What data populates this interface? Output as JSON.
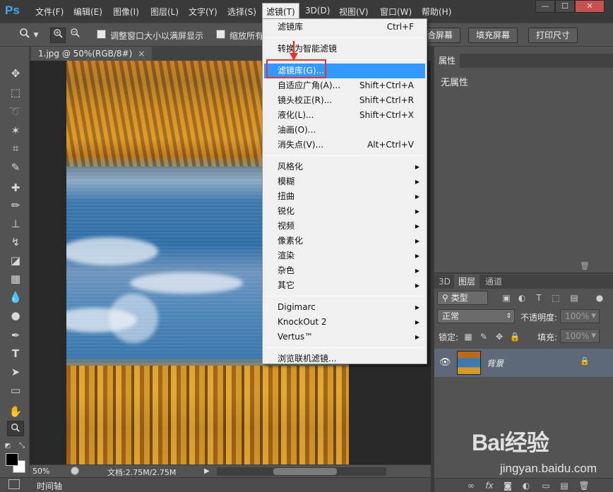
{
  "app": {
    "logo": "Ps"
  },
  "menubar": {
    "items": [
      "文件(F)",
      "编辑(E)",
      "图像(I)",
      "图层(L)",
      "文字(Y)",
      "选择(S)",
      "滤镜(T)",
      "3D(D)",
      "视图(V)",
      "窗口(W)",
      "帮助(H)"
    ],
    "active_index": 6,
    "window_buttons": [
      "—",
      "☐",
      "✕"
    ]
  },
  "options_bar": {
    "resize_windows_label": "调整窗口大小以满屏显示",
    "zoom_all_label": "缩放所有",
    "buttons": [
      "合屏幕",
      "填充屏幕",
      "打印尺寸"
    ]
  },
  "document": {
    "tab_title": "1.jpg @ 50%(RGB/8#)",
    "tab_close": "×",
    "zoom": "50%",
    "doc_info": "文档:2.75M/2.75M"
  },
  "timeline": {
    "label": "时间轴"
  },
  "filter_menu": {
    "items": [
      {
        "label": "滤镜库",
        "shortcut": "Ctrl+F",
        "submenu": false
      },
      {
        "separator": true
      },
      {
        "label": "转换为智能滤镜",
        "shortcut": "",
        "submenu": false
      },
      {
        "separator": true
      },
      {
        "label": "滤镜库(G)...",
        "shortcut": "",
        "submenu": false,
        "highlighted": true
      },
      {
        "label": "自适应广角(A)...",
        "shortcut": "Shift+Ctrl+A",
        "submenu": false
      },
      {
        "label": "镜头校正(R)...",
        "shortcut": "Shift+Ctrl+R",
        "submenu": false
      },
      {
        "label": "液化(L)...",
        "shortcut": "Shift+Ctrl+X",
        "submenu": false
      },
      {
        "label": "油画(O)...",
        "shortcut": "",
        "submenu": false
      },
      {
        "label": "消失点(V)...",
        "shortcut": "Alt+Ctrl+V",
        "submenu": false
      },
      {
        "separator": true
      },
      {
        "label": "风格化",
        "shortcut": "",
        "submenu": true
      },
      {
        "label": "模糊",
        "shortcut": "",
        "submenu": true
      },
      {
        "label": "扭曲",
        "shortcut": "",
        "submenu": true
      },
      {
        "label": "锐化",
        "shortcut": "",
        "submenu": true
      },
      {
        "label": "视频",
        "shortcut": "",
        "submenu": true
      },
      {
        "label": "像素化",
        "shortcut": "",
        "submenu": true
      },
      {
        "label": "渲染",
        "shortcut": "",
        "submenu": true
      },
      {
        "label": "杂色",
        "shortcut": "",
        "submenu": true
      },
      {
        "label": "其它",
        "shortcut": "",
        "submenu": true
      },
      {
        "separator": true
      },
      {
        "label": "Digimarc",
        "shortcut": "",
        "submenu": true
      },
      {
        "label": "KnockOut 2",
        "shortcut": "",
        "submenu": true
      },
      {
        "label": "Vertus™",
        "shortcut": "",
        "submenu": true
      },
      {
        "separator": true
      },
      {
        "label": "浏览联机滤镜...",
        "shortcut": "",
        "submenu": false
      }
    ]
  },
  "properties_panel": {
    "tab": "属性",
    "empty_text": "无属性"
  },
  "layers_panel": {
    "tabs": [
      "3D",
      "图层",
      "通道"
    ],
    "active_tab": 1,
    "kind_filter": "类型",
    "blend_mode": "正常",
    "opacity_label": "不透明度:",
    "opacity_value": "100%",
    "lock_label": "锁定:",
    "fill_label": "填充:",
    "fill_value": "100%",
    "layer_name": "背景"
  },
  "watermark": {
    "logo": "Bai经验",
    "url": "jingyan.baidu.com"
  },
  "colors": {
    "accent": "#3399ff",
    "highlight_box": "#e8322e",
    "ps_blue": "#47a3f3"
  }
}
